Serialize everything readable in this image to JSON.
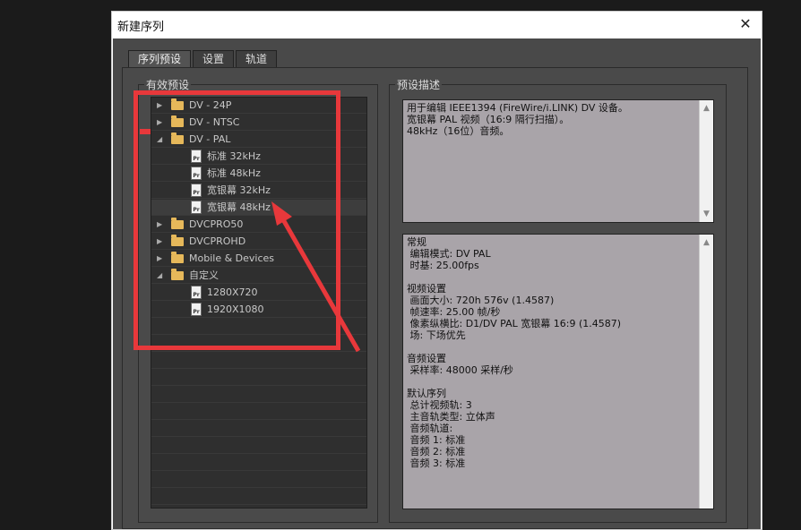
{
  "window": {
    "title": "新建序列"
  },
  "tabs": [
    {
      "label": "序列预设",
      "active": true
    },
    {
      "label": "设置",
      "active": false
    },
    {
      "label": "轨道",
      "active": false
    }
  ],
  "presets_panel": {
    "label": "有效预设"
  },
  "tree": [
    {
      "type": "folder",
      "label": "DV - 24P",
      "expanded": false,
      "level": 0
    },
    {
      "type": "folder",
      "label": "DV - NTSC",
      "expanded": false,
      "level": 0
    },
    {
      "type": "folder",
      "label": "DV - PAL",
      "expanded": true,
      "level": 0
    },
    {
      "type": "file",
      "label": "标准 32kHz",
      "level": 1
    },
    {
      "type": "file",
      "label": "标准 48kHz",
      "level": 1
    },
    {
      "type": "file",
      "label": "宽银幕 32kHz",
      "level": 1
    },
    {
      "type": "file",
      "label": "宽银幕 48kHz",
      "level": 1,
      "selected": true
    },
    {
      "type": "folder",
      "label": "DVCPRO50",
      "expanded": false,
      "level": 0
    },
    {
      "type": "folder",
      "label": "DVCPROHD",
      "expanded": false,
      "level": 0
    },
    {
      "type": "folder",
      "label": "Mobile & Devices",
      "expanded": false,
      "level": 0
    },
    {
      "type": "folder",
      "label": "自定义",
      "expanded": true,
      "level": 0
    },
    {
      "type": "file",
      "label": "1280X720",
      "level": 1
    },
    {
      "type": "file",
      "label": "1920X1080",
      "level": 1
    }
  ],
  "file_icon_text": "Pr",
  "description_panel": {
    "label": "预设描述",
    "summary": [
      "用于编辑 IEEE1394 (FireWire/i.LINK) DV 设备。",
      "宽银幕 PAL 视频（16:9 隔行扫描）。",
      "48kHz（16位）音频。"
    ],
    "details": [
      "常规",
      " 编辑模式: DV PAL",
      " 时基: 25.00fps",
      "",
      "视频设置",
      " 画面大小: 720h 576v (1.4587)",
      " 帧速率: 25.00 帧/秒",
      " 像素纵横比: D1/DV PAL 宽银幕 16:9 (1.4587)",
      " 场: 下场优先",
      "",
      "音频设置",
      " 采样率: 48000 采样/秒",
      "",
      "默认序列",
      " 总计视频轨: 3",
      " 主音轨类型: 立体声",
      " 音频轨道:",
      " 音频 1: 标准",
      " 音频 2: 标准",
      " 音频 3: 标准"
    ]
  },
  "colors": {
    "annotation_red": "#e8383b",
    "folder": "#e6b85a",
    "desc_bg": "#a9a4a9"
  }
}
